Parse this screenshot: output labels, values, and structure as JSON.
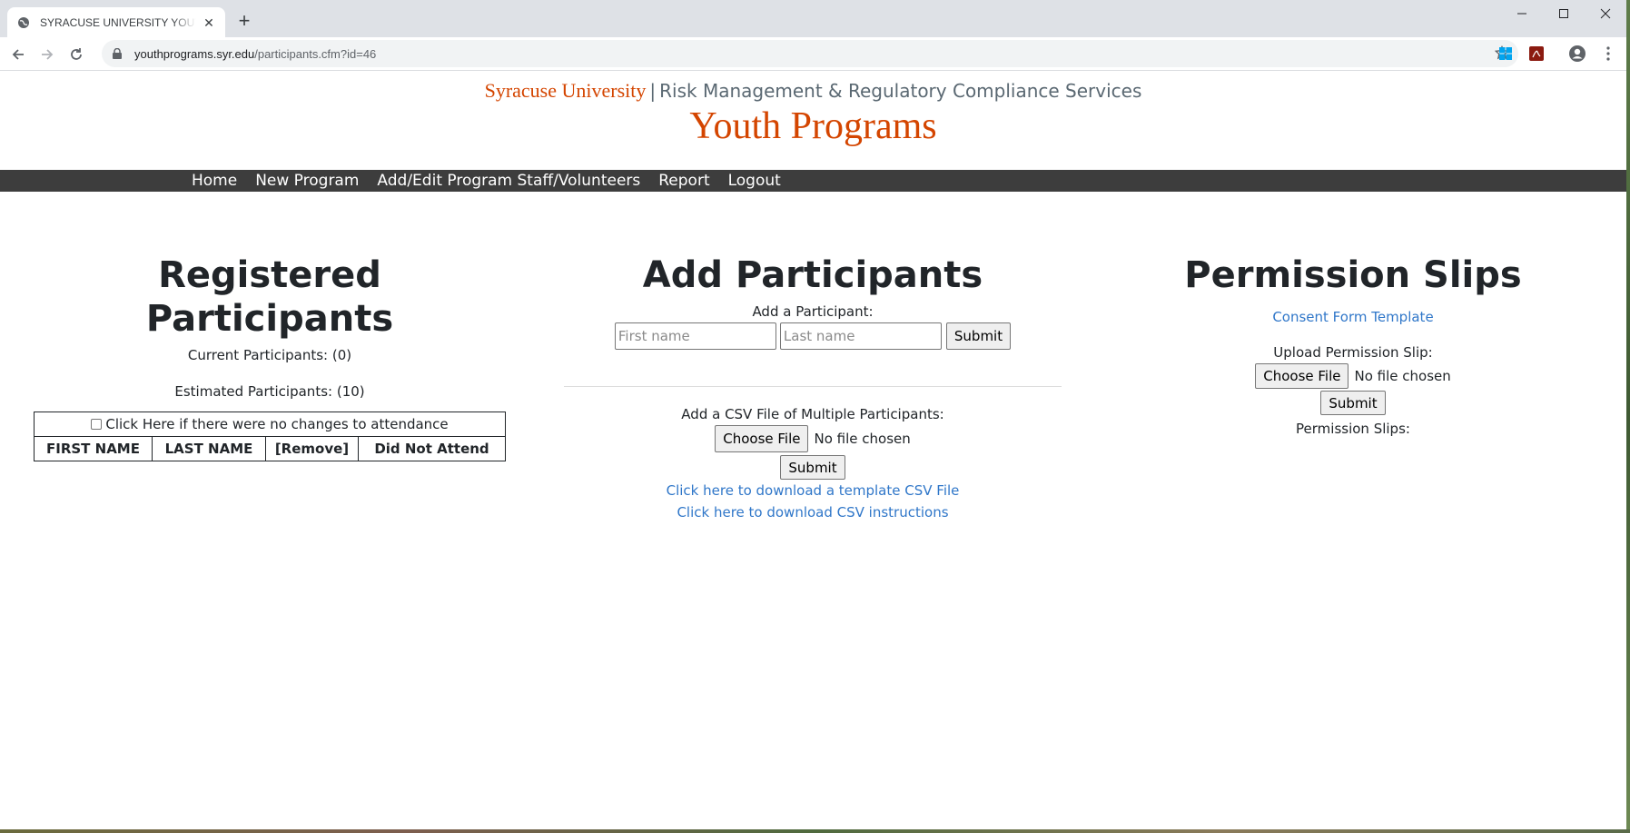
{
  "browser": {
    "tab_title": "SYRACUSE UNIVERSITY YOUTH P",
    "url_host": "youthprograms.syr.edu",
    "url_path": "/participants.cfm?id=46"
  },
  "header": {
    "brand_university": "Syracuse University",
    "brand_separator": "|",
    "brand_department": "Risk Management & Regulatory Compliance Services",
    "site_title": "Youth Programs"
  },
  "nav": {
    "items": [
      "Home",
      "New Program",
      "Add/Edit Program Staff/Volunteers",
      "Report",
      "Logout"
    ]
  },
  "registered": {
    "heading": "Registered Participants",
    "current": "Current Participants: (0)",
    "estimated": "Estimated Participants: (10)",
    "no_changes_label": "Click Here if there were no changes to attendance",
    "columns": [
      "FIRST NAME",
      "LAST NAME",
      "[Remove]",
      "Did Not Attend"
    ]
  },
  "add": {
    "heading": "Add Participants",
    "single_label": "Add a Participant:",
    "first_placeholder": "First name",
    "last_placeholder": "Last name",
    "submit": "Submit",
    "csv_label": "Add a CSV File of Multiple Participants:",
    "choose_file": "Choose File",
    "no_file": "No file chosen",
    "template_link": "Click here to download a template CSV File",
    "instructions_link": "Click here to download CSV instructions"
  },
  "permission": {
    "heading": "Permission Slips",
    "consent_link": "Consent Form Template",
    "upload_label": "Upload Permission Slip:",
    "choose_file": "Choose File",
    "no_file": "No file chosen",
    "submit": "Submit",
    "slips_label": "Permission Slips:"
  },
  "colors": {
    "brand_orange": "#d44500",
    "nav_bg": "#3d3d3d",
    "link": "#3077c9"
  }
}
